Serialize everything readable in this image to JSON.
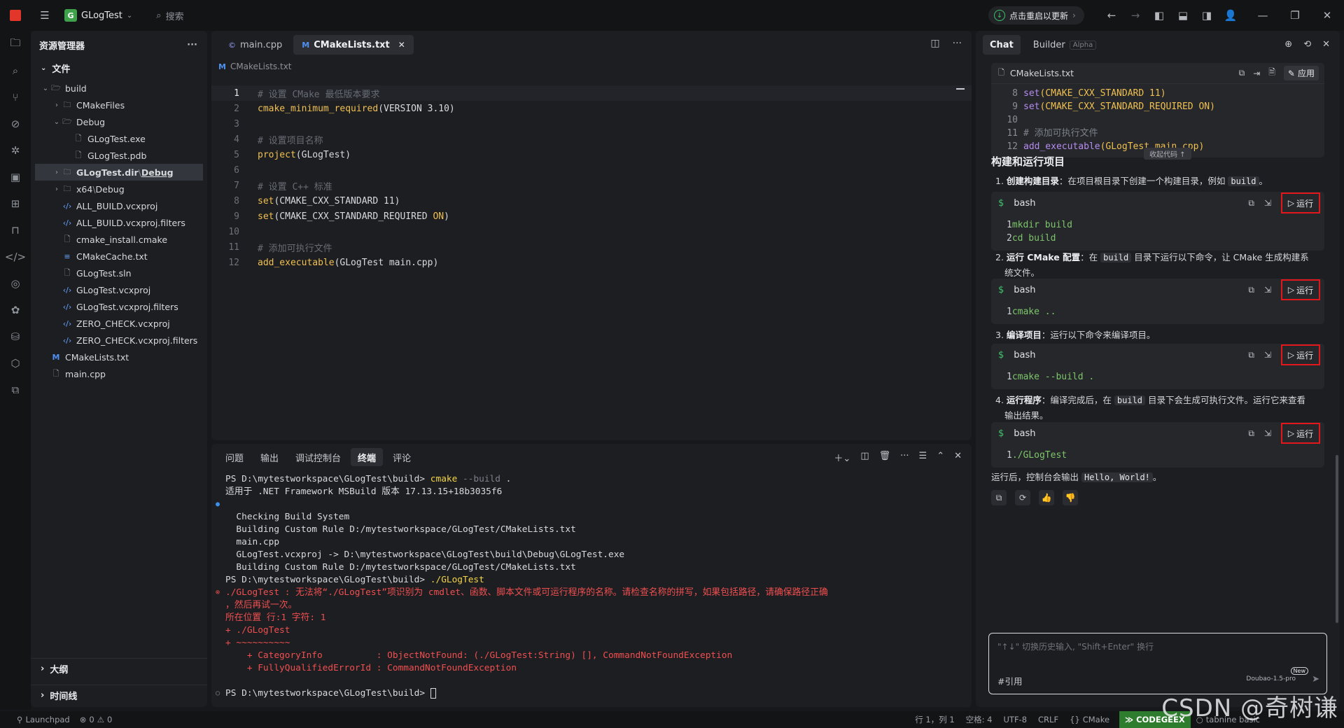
{
  "titlebar": {
    "project_name": "GLogTest",
    "project_badge": "G",
    "search_label": "搜索",
    "restart_label": "点击重启以更新"
  },
  "explorer": {
    "title": "资源管理器",
    "section_files": "文件",
    "items": [
      {
        "label": "build",
        "depth": 0,
        "kind": "folder",
        "open": true
      },
      {
        "label": "CMakeFiles",
        "depth": 1,
        "kind": "folder",
        "open": false
      },
      {
        "label": "Debug",
        "depth": 1,
        "kind": "folder",
        "open": true
      },
      {
        "label": "GLogTest.exe",
        "depth": 2,
        "kind": "file"
      },
      {
        "label": "GLogTest.pdb",
        "depth": 2,
        "kind": "file"
      },
      {
        "label": "GLogTest.dir",
        "suffix": "Debug",
        "depth": 1,
        "kind": "folder",
        "open": false,
        "selected": true
      },
      {
        "label": "x64",
        "suffix": "Debug",
        "depth": 1,
        "kind": "folder",
        "open": false
      },
      {
        "label": "ALL_BUILD.vcxproj",
        "depth": 1,
        "kind": "xml"
      },
      {
        "label": "ALL_BUILD.vcxproj.filters",
        "depth": 1,
        "kind": "xml"
      },
      {
        "label": "cmake_install.cmake",
        "depth": 1,
        "kind": "file"
      },
      {
        "label": "CMakeCache.txt",
        "depth": 1,
        "kind": "lines"
      },
      {
        "label": "GLogTest.sln",
        "depth": 1,
        "kind": "file"
      },
      {
        "label": "GLogTest.vcxproj",
        "depth": 1,
        "kind": "xml"
      },
      {
        "label": "GLogTest.vcxproj.filters",
        "depth": 1,
        "kind": "xml"
      },
      {
        "label": "ZERO_CHECK.vcxproj",
        "depth": 1,
        "kind": "xml"
      },
      {
        "label": "ZERO_CHECK.vcxproj.filters",
        "depth": 1,
        "kind": "xml"
      },
      {
        "label": "CMakeLists.txt",
        "depth": 0,
        "kind": "cmake"
      },
      {
        "label": "main.cpp",
        "depth": 0,
        "kind": "file"
      }
    ],
    "section_outline": "大纲",
    "section_timeline": "时间线"
  },
  "editor": {
    "tabs": [
      {
        "label": "main.cpp",
        "icon": "C"
      },
      {
        "label": "CMakeLists.txt",
        "icon": "M"
      }
    ],
    "breadcrumb": "CMakeLists.txt",
    "lines": [
      {
        "n": "1",
        "parts": [
          {
            "t": "# 设置 CMake 最低版本要求",
            "c": "c"
          }
        ]
      },
      {
        "n": "2",
        "parts": [
          {
            "t": "cmake_minimum_required",
            "c": "f"
          },
          {
            "t": "(VERSION 3.10)",
            "c": "t"
          }
        ]
      },
      {
        "n": "3",
        "parts": []
      },
      {
        "n": "4",
        "parts": [
          {
            "t": "# 设置项目名称",
            "c": "c"
          }
        ]
      },
      {
        "n": "5",
        "parts": [
          {
            "t": "project",
            "c": "f"
          },
          {
            "t": "(GLogTest)",
            "c": "t"
          }
        ]
      },
      {
        "n": "6",
        "parts": []
      },
      {
        "n": "7",
        "parts": [
          {
            "t": "# 设置 C++ 标准",
            "c": "c"
          }
        ]
      },
      {
        "n": "8",
        "parts": [
          {
            "t": "set",
            "c": "f"
          },
          {
            "t": "(CMAKE_CXX_STANDARD 11)",
            "c": "t"
          }
        ]
      },
      {
        "n": "9",
        "parts": [
          {
            "t": "set",
            "c": "f"
          },
          {
            "t": "(CMAKE_CXX_STANDARD_REQUIRED ",
            "c": "t"
          },
          {
            "t": "ON",
            "c": "k"
          },
          {
            "t": ")",
            "c": "t"
          }
        ]
      },
      {
        "n": "10",
        "parts": []
      },
      {
        "n": "11",
        "parts": [
          {
            "t": "# 添加可执行文件",
            "c": "c"
          }
        ]
      },
      {
        "n": "12",
        "parts": [
          {
            "t": "add_executable",
            "c": "f"
          },
          {
            "t": "(GLogTest main.cpp)",
            "c": "t"
          }
        ]
      }
    ]
  },
  "panel": {
    "tabs": [
      "问题",
      "输出",
      "调试控制台",
      "终端",
      "评论"
    ],
    "active_tab": "终端",
    "terminal_lines": [
      {
        "parts": [
          {
            "t": "PS D:\\mytestworkspace\\GLogTest\\build> ",
            "c": "w"
          },
          {
            "t": "cmake",
            "c": "y"
          },
          {
            "t": " --build",
            "c": "g"
          },
          {
            "t": " .",
            "c": "w"
          }
        ]
      },
      {
        "parts": [
          {
            "t": "适用于 .NET Framework MSBuild 版本 17.13.15+18b3035f6",
            "c": "w"
          }
        ]
      },
      {
        "parts": [],
        "marker": "●",
        "markerColor": "#3d8ee6"
      },
      {
        "parts": [
          {
            "t": "  Checking Build System",
            "c": "w"
          }
        ]
      },
      {
        "parts": [
          {
            "t": "  Building Custom Rule D:/mytestworkspace/GLogTest/CMakeLists.txt",
            "c": "w"
          }
        ]
      },
      {
        "parts": [
          {
            "t": "  main.cpp",
            "c": "w"
          }
        ]
      },
      {
        "parts": [
          {
            "t": "  GLogTest.vcxproj -> D:\\mytestworkspace\\GLogTest\\build\\Debug\\GLogTest.exe",
            "c": "w"
          }
        ]
      },
      {
        "parts": [
          {
            "t": "  Building Custom Rule D:/mytestworkspace/GLogTest/CMakeLists.txt",
            "c": "w"
          }
        ]
      },
      {
        "parts": [
          {
            "t": "PS D:\\mytestworkspace\\GLogTest\\build> ",
            "c": "w"
          },
          {
            "t": "./GLogTest",
            "c": "y"
          }
        ]
      },
      {
        "parts": [
          {
            "t": "./GLogTest : 无法将“./GLogTest”项识别为 cmdlet、函数、脚本文件或可运行程序的名称。请检查名称的拼写，如果包括路径，请确保路径正确",
            "c": "r"
          }
        ],
        "marker": "⊗",
        "markerColor": "#f04f4f"
      },
      {
        "parts": [
          {
            "t": "，然后再试一次。",
            "c": "r"
          }
        ]
      },
      {
        "parts": [
          {
            "t": "所在位置 行:1 字符: 1",
            "c": "r"
          }
        ]
      },
      {
        "parts": [
          {
            "t": "+ ./GLogTest",
            "c": "r"
          }
        ]
      },
      {
        "parts": [
          {
            "t": "+ ~~~~~~~~~~",
            "c": "r"
          }
        ]
      },
      {
        "parts": [
          {
            "t": "    + CategoryInfo          : ObjectNotFound: (./GLogTest:String) [], CommandNotFoundException",
            "c": "r"
          }
        ]
      },
      {
        "parts": [
          {
            "t": "    + FullyQualifiedErrorId : CommandNotFoundException",
            "c": "r"
          }
        ]
      },
      {
        "parts": []
      },
      {
        "parts": [
          {
            "t": "PS D:\\mytestworkspace\\GLogTest\\build> ",
            "c": "w"
          }
        ],
        "marker": "○",
        "markerColor": "#7c8089",
        "cursor": true
      }
    ]
  },
  "chat": {
    "tabs": [
      "Chat",
      "Builder"
    ],
    "alpha_badge": "Alpha",
    "file_card": {
      "filename": "CMakeLists.txt",
      "apply_label": "应用",
      "collapse_label": "收起代码 ↑",
      "lines": [
        {
          "n": "8",
          "parts": [
            {
              "t": "set",
              "c": "p"
            },
            {
              "t": "(",
              "c": "y"
            },
            {
              "t": "CMAKE_CXX_STANDARD 11",
              "c": "y"
            },
            {
              "t": ")",
              "c": "y"
            }
          ]
        },
        {
          "n": "9",
          "parts": [
            {
              "t": "set",
              "c": "p"
            },
            {
              "t": "(CMAKE_CXX_STANDARD_REQUIRED ON)",
              "c": "y"
            }
          ]
        },
        {
          "n": "10",
          "parts": []
        },
        {
          "n": "11",
          "parts": [
            {
              "t": "# 添加可执行文件",
              "c": "g"
            }
          ]
        },
        {
          "n": "12",
          "parts": [
            {
              "t": "add_executable",
              "c": "p"
            },
            {
              "t": "(GLogTest main.cpp)",
              "c": "y"
            }
          ]
        }
      ]
    },
    "heading": "构建和运行项目",
    "steps": [
      {
        "prefix": "1. ",
        "bold": "创建构建目录",
        "text": "：在项目根目录下创建一个构建目录，例如 ",
        "code": "build",
        "tail": "。",
        "text2": ""
      },
      {
        "prefix": "2. ",
        "bold": "运行 CMake 配置",
        "text": "：在 ",
        "code": "build",
        "tail": " 目录下运行以下命令，让 CMake 生成构建系",
        "text2": "统文件。"
      },
      {
        "prefix": "3. ",
        "bold": "编译项目",
        "text": "：运行以下命令来编译项目。",
        "code": "",
        "tail": "",
        "text2": ""
      },
      {
        "prefix": "4. ",
        "bold": "运行程序",
        "text": "：编译完成后，在 ",
        "code": "build",
        "tail": " 目录下会生成可执行文件。运行它来查看",
        "text2": "输出结果。"
      }
    ],
    "bash_label": "bash",
    "run_label": "运行",
    "bash_blocks": [
      [
        {
          "n": "1",
          "t": "mkdir build"
        },
        {
          "n": "2",
          "t": "cd build"
        }
      ],
      [
        {
          "n": "1",
          "t": "cmake .."
        }
      ],
      [
        {
          "n": "1",
          "t": "cmake --build ."
        }
      ],
      [
        {
          "n": "1",
          "t": "./GLogTest"
        }
      ]
    ],
    "after_text": "运行后，控制台会输出 ",
    "after_code": "Hello, World!",
    "after_tail": "。",
    "input_placeholder": "\"↑↓\" 切换历史输入, \"Shift+Enter\" 换行",
    "input_ref": "#引用",
    "model_name": "Doubao-1.5-pro",
    "new_badge": "New"
  },
  "status": {
    "launchpad": "Launchpad",
    "errors": "0",
    "warnings": "0",
    "position": "行 1，列 1",
    "spaces": "空格: 4",
    "encoding": "UTF-8",
    "eol": "CRLF",
    "language": "CMake",
    "codegeex": "CODEGEEX",
    "tabnine": "tabnine basic"
  },
  "watermark": "CSDN @奇树谦"
}
